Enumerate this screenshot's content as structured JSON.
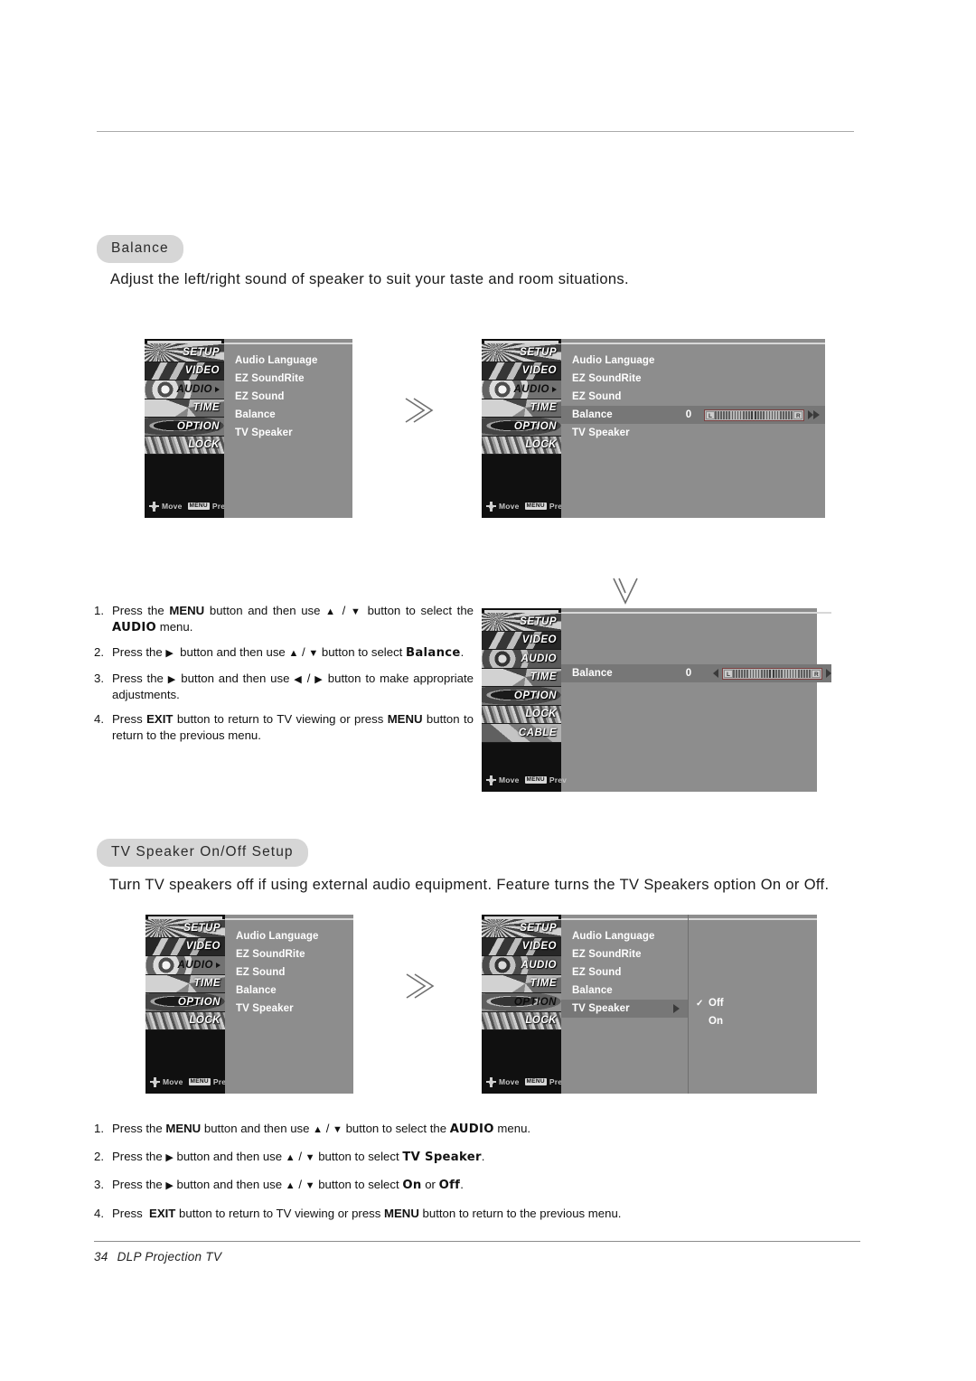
{
  "page": {
    "number": "34",
    "footer_title": "DLP Projection TV"
  },
  "sections": [
    {
      "id": "balance",
      "heading": "Balance",
      "description": "Adjust the left/right sound of speaker to suit your taste and room situations."
    },
    {
      "id": "tv_speaker",
      "heading": "TV Speaker On/Off Setup",
      "description": "Turn TV speakers off if using external audio equipment. Feature turns the TV Speakers option On or Off."
    }
  ],
  "osd": {
    "rail_labels_base": [
      "SETUP",
      "VIDEO",
      "AUDIO",
      "TIME",
      "OPTION",
      "LOCK"
    ],
    "rail_labels_with_cable": [
      "SETUP",
      "VIDEO",
      "AUDIO",
      "TIME",
      "OPTION",
      "LOCK",
      "CABLE"
    ],
    "footer_move": "Move",
    "footer_prev": "Prev",
    "footer_menu_key": "MENU",
    "audio_menu_items": [
      "Audio Language",
      "EZ SoundRite",
      "EZ Sound",
      "Balance",
      "TV Speaker"
    ],
    "balance_value": "0",
    "slider_left_label": "L",
    "slider_right_label": "R",
    "tv_speaker_options": [
      "Off",
      "On"
    ],
    "tv_speaker_selected": "Off",
    "check_glyph": "✓"
  },
  "menu_screens": {
    "balance_before": {
      "active_rail": "AUDIO",
      "highlight_row": null
    },
    "balance_after": {
      "active_rail": "AUDIO",
      "highlight_row": "Balance"
    },
    "balance_adjust": {
      "active_rail": "TIME",
      "highlight_row": "Balance"
    },
    "speaker_before": {
      "active_rail": "AUDIO",
      "highlight_row": null
    },
    "speaker_after": {
      "active_rail": "OPTION",
      "highlight_row": "TV Speaker"
    }
  },
  "steps_balance": [
    {
      "num": "1.",
      "html": "Press the <b>MENU</b> button and then use <span class=\"arw\">▲</span> / <span class=\"arw\">▼</span> button to select the <span class=\"blocky\">AUDIO</span> menu."
    },
    {
      "num": "2.",
      "html": "Press the <span class=\"arw\">▶</span>&nbsp; button and then use <span class=\"arw\">▲</span> / <span class=\"arw\">▼</span> button to select <span class=\"blocky\">Balance</span>."
    },
    {
      "num": "3.",
      "html": "Press the <span class=\"arw\">▶</span> button and then use <span class=\"arw\">◀</span> / <span class=\"arw\">▶</span> button to make appropriate adjustments."
    },
    {
      "num": "4.",
      "html": "Press <b>EXIT</b> button to return to TV viewing or press <b>MENU</b> button to return to the previous menu."
    }
  ],
  "steps_tv_speaker": [
    {
      "num": "1.",
      "html": "Press the <b>MENU</b> button and then use <span class=\"arw\">▲</span> / <span class=\"arw\">▼</span> button to select the <span class=\"blocky\">AUDIO</span> menu."
    },
    {
      "num": "2.",
      "html": "Press the <span class=\"arw\">▶</span> button and then use <span class=\"arw\">▲</span> / <span class=\"arw\">▼</span> button to select <span class=\"blocky\">TV Speaker</span>."
    },
    {
      "num": "3.",
      "html": "Press the <span class=\"arw\">▶</span> button and then use <span class=\"arw\">▲</span> / <span class=\"arw\">▼</span> button to select <span class=\"blocky\">On</span> or <span class=\"blocky\">Off</span>."
    },
    {
      "num": "4.",
      "html": "Press&nbsp; <b>EXIT</b> button to return to TV viewing or press <b>MENU</b> button to return to the previous menu."
    }
  ],
  "colors": {
    "pill_bg": "#d6d6d6",
    "osd_panel": "#8d8d8d",
    "osd_rail": "#101010",
    "osd_highlight": "#777777",
    "text_white": "#ffffff"
  }
}
